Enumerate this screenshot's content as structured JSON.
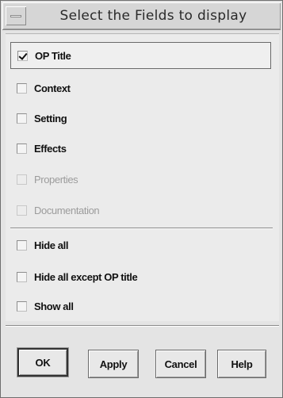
{
  "window": {
    "title": "Select the Fields to display"
  },
  "fields": [
    {
      "label": "OP Title",
      "checked": true,
      "enabled": true
    },
    {
      "label": "Context",
      "checked": false,
      "enabled": true
    },
    {
      "label": "Setting",
      "checked": false,
      "enabled": true
    },
    {
      "label": "Effects",
      "checked": false,
      "enabled": true
    },
    {
      "label": "Properties",
      "checked": false,
      "enabled": false
    },
    {
      "label": "Documentation",
      "checked": false,
      "enabled": false
    }
  ],
  "bulk_options": [
    {
      "label": "Hide all",
      "checked": false
    },
    {
      "label": "Hide all except OP title",
      "checked": false
    },
    {
      "label": "Show all",
      "checked": false
    }
  ],
  "buttons": {
    "ok": "OK",
    "apply": "Apply",
    "cancel": "Cancel",
    "help": "Help"
  }
}
